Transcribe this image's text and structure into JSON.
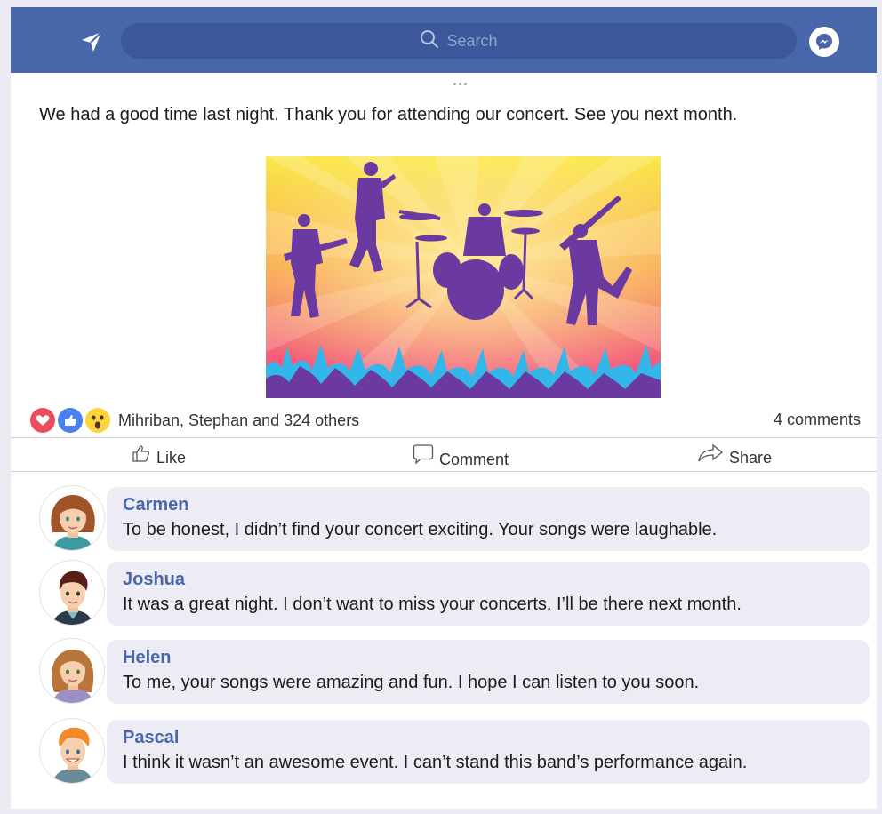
{
  "colors": {
    "brand": "#4867aa",
    "link": "#4867aa",
    "bubble": "#edebf4"
  },
  "header": {
    "send_icon": "paper-plane-icon",
    "search_icon": "search-icon",
    "search_placeholder": "Search",
    "messenger_icon": "messenger-icon"
  },
  "post": {
    "text": "We had a good time last night. Thank you for attending our concert. See you next month.",
    "image_alt": "concert-band-silhouette-image",
    "reactions": {
      "icons": [
        "heart-icon",
        "thumbs-up-icon",
        "wow-face-icon"
      ],
      "names": "Mihriban, Stephan and 324 others"
    },
    "comment_count": "4 comments",
    "actions": {
      "like": "Like",
      "comment": "Comment",
      "share": "Share"
    }
  },
  "comments": [
    {
      "name": "Carmen",
      "text": "To be honest, I didn’t find your concert exciting. Your songs were laughable."
    },
    {
      "name": "Joshua",
      "text": "It was a great night. I don’t want to miss your concerts. I’ll be there next month."
    },
    {
      "name": "Helen",
      "text": "To me, your songs were amazing and fun. I hope I can listen to you soon."
    },
    {
      "name": "Pascal",
      "text": "I think it wasn’t an awesome event. I can’t stand this band’s performance again."
    }
  ]
}
